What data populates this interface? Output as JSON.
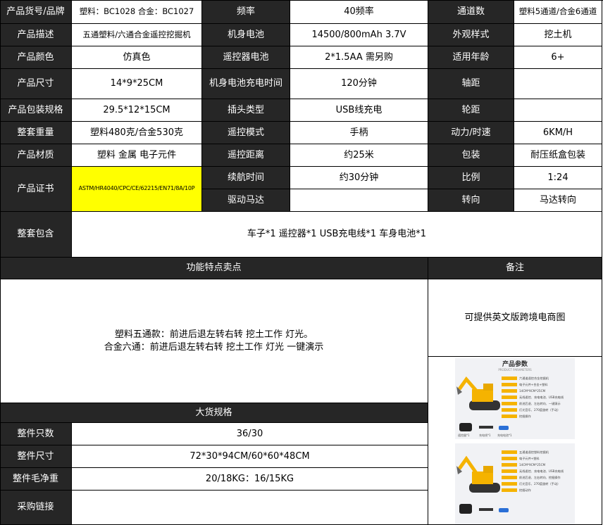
{
  "row1": {
    "product_code_label": "产品货号/品牌",
    "product_code_value": "塑料：BC1028 合金：BC1027",
    "frequency_label": "频率",
    "frequency_value": "40频率",
    "channels_label": "通道数",
    "channels_value": "塑料5通道/合金6通道"
  },
  "row2": {
    "description_label": "产品描述",
    "description_value": "五通塑料/六通合金遥控挖掘机",
    "body_battery_label": "机身电池",
    "body_battery_value": "14500/800mAh 3.7V",
    "appearance_label": "外观样式",
    "appearance_value": "挖土机"
  },
  "row3": {
    "color_label": "产品颜色",
    "color_value": "仿真色",
    "remote_battery_label": "遥控器电池",
    "remote_battery_value": "2*1.5AA 需另购",
    "age_label": "适用年龄",
    "age_value": "6+"
  },
  "row4": {
    "size_label": "产品尺寸",
    "size_value": "14*9*25CM",
    "charge_time_label": "机身电池充电时间",
    "charge_time_value": "120分钟",
    "wheelbase_label": "轴距",
    "wheelbase_value": ""
  },
  "row5": {
    "package_size_label": "产品包装规格",
    "package_size_value": "29.5*12*15CM",
    "plug_label": "插头类型",
    "plug_value": "USB线充电",
    "track_label": "轮距",
    "track_value": ""
  },
  "row6": {
    "weight_label": "整套重量",
    "weight_value": "塑料480克/合金530克",
    "control_mode_label": "遥控模式",
    "control_mode_value": "手柄",
    "power_label": "动力/时速",
    "power_value": "6KM/H"
  },
  "row7": {
    "material_label": "产品材质",
    "material_value": "塑料 金属 电子元件",
    "distance_label": "遥控距离",
    "distance_value": "约25米",
    "packing_label": "包装",
    "packing_value": "耐压纸盒包装"
  },
  "row8": {
    "cert_label": "产品证书",
    "cert_value": "ASTM/HR4040/CPC/CE/62215/EN71/8A/10P",
    "endurance_label": "续航时间",
    "endurance_value": "约30分钟",
    "scale_label": "比例",
    "scale_value": "1:24",
    "motor_label": "驱动马达",
    "motor_value": "",
    "steering_label": "转向",
    "steering_value": "马达转向"
  },
  "contents": {
    "label": "整套包含",
    "value": "车子*1  遥控器*1 USB充电线*1 车身电池*1"
  },
  "features": {
    "header": "功能特点卖点",
    "line1": "塑料五通款：前进后退左转右转 挖土工作 灯光。",
    "line2": "合金六通：前进后退左转右转 挖土工作 灯光 一键演示"
  },
  "remarks": {
    "header": "备注",
    "value": "可提供英文版跨境电商图"
  },
  "bulk": {
    "header": "大货规格",
    "qty_label": "整件只数",
    "qty_value": "36/30",
    "carton_size_label": "整件尺寸",
    "carton_size_value": "72*30*94CM/60*60*48CM",
    "weight_label": "整件毛净重",
    "weight_value": "20/18KG：16/15KG",
    "link_label": "采购链接",
    "link_value": ""
  },
  "poster": {
    "title": "产品参数",
    "subtitle": "PRODUCT PARAMETERS",
    "card1_lines": [
      "六通道遥控合金挖掘机",
      "电子元件+合金+塑料",
      "14CM*9CM*25CM",
      "无线遥控、充电电池、USB充电线",
      "前进后退、左右转向、一键演示",
      "灯光音乐、270度旋转（手动）",
      "挖掘操作"
    ],
    "card2_lines": [
      "五通道遥控塑料挖掘机",
      "电子元件+塑料",
      "14CM*9CM*25CM",
      "无线遥控、充电电池、USB充电线",
      "前进后退、左右转向、挖掘操作",
      "灯光音乐、270度旋转（手动）",
      "挖掘动作"
    ],
    "remote_label": "遥控器*1",
    "charger_label": "充电线*1",
    "battery_label": "充电电池*1",
    "colors": {
      "accent": "#f5b300",
      "card": "#f1f2f5",
      "header_dark": "#262626",
      "cert_bg": "#ffff00"
    }
  }
}
